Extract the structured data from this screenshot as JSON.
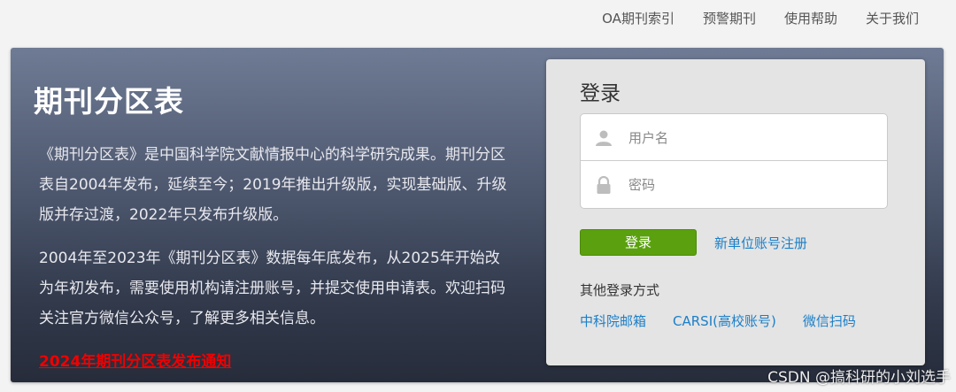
{
  "topnav": {
    "links": [
      "OA期刊索引",
      "预警期刊",
      "使用帮助",
      "关于我们"
    ]
  },
  "hero": {
    "title": "期刊分区表",
    "paragraph1": "《期刊分区表》是中国科学院文献情报中心的科学研究成果。期刊分区表自2004年发布，延续至今；2019年推出升级版，实现基础版、升级版并存过渡，2022年只发布升级版。",
    "paragraph2": "2004年至2023年《期刊分区表》数据每年底发布，从2025年开始改为年初发布，需要使用机构请注册账号，并提交使用申请表。欢迎扫码关注官方微信公众号，了解更多相关信息。",
    "notice_link": "2024年期刊分区表发布通知"
  },
  "login": {
    "title": "登录",
    "username_placeholder": "用户名",
    "password_placeholder": "密码",
    "login_button": "登录",
    "register_link": "新单位账号注册",
    "other_methods_label": "其他登录方式",
    "alt_methods": [
      "中科院邮箱",
      "CARSI(高校账号)",
      "微信扫码"
    ]
  },
  "watermark": "CSDN @搞科研的小刘选手",
  "colors": {
    "login_button": "#5ba10f",
    "link": "#1b7fc8",
    "notice": "#f00000"
  },
  "icons": {
    "username": "user-icon",
    "password": "lock-icon"
  }
}
